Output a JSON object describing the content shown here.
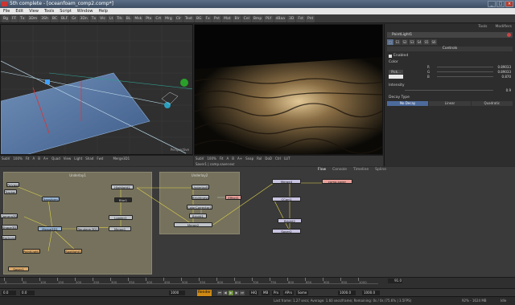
{
  "window": {
    "title": "5th complete - [oceanfoam_comp2.comp*]",
    "controls": [
      "_",
      "□",
      "×"
    ]
  },
  "menu": [
    "File",
    "Edit",
    "View",
    "Tools",
    "Script",
    "Window",
    "Help"
  ],
  "toolbar": [
    "Bg",
    "FF",
    "Tx",
    "3Dm",
    "3Sh",
    "BC",
    "BLF",
    "Gr",
    "3Dn",
    "Tx",
    "Vlc",
    "Lt",
    "Trk",
    "BL",
    "Msk",
    "Ptx",
    "Crt",
    "Mrg",
    "Clr",
    "Text",
    "BG",
    "Fx",
    "Pnt",
    "Mat",
    "Blr",
    "Cel",
    "Bmp",
    "PLY",
    "dBaa",
    "3D",
    "Fst",
    "Pnt"
  ],
  "viewer1": {
    "label": "Perspective",
    "bar": [
      "SubV",
      "100%",
      "Fit",
      "A",
      "B",
      "A+",
      "Quad",
      "View",
      "Light",
      "Shad",
      "Fwd"
    ],
    "camera": "Merge3D1"
  },
  "viewer2": {
    "bar": [
      "SubV",
      "100%",
      "Fit",
      "A",
      "B",
      "A+",
      "Snap",
      "RoI",
      "DoD",
      "Ctrl",
      "LUT"
    ],
    "info": "Saver1 | comp.saver.exr"
  },
  "panel": {
    "tabs": [
      "Tools",
      "Modifiers"
    ],
    "header": "PointLight1",
    "tool_tabs": [
      "□",
      "S1",
      "S2",
      "S3",
      "S4",
      "S5",
      "S6"
    ],
    "section": "Controls",
    "enabled": "Enabled",
    "color_label": "Color",
    "color_rows": [
      {
        "k": "R",
        "v": "0.89033"
      },
      {
        "k": "G",
        "v": "0.89033"
      },
      {
        "k": "B",
        "v": "0.870"
      }
    ],
    "pick": "Pick...",
    "intensity_label": "Intensity",
    "intensity": "0.9",
    "decay_label": "Decay Type",
    "decay": [
      "No Decay",
      "Linear",
      "Quadratic"
    ]
  },
  "flow": {
    "tabs": [
      "Flow",
      "Console",
      "Timeline",
      "Spline"
    ],
    "groups": [
      {
        "label": "Underlay1"
      },
      {
        "label": "Underlay2"
      }
    ],
    "nodes": [
      "Polygon1",
      "Tracker1",
      "Transform1",
      "Merge3D1",
      "Camera3D1",
      "Shape3D1",
      "Renderer3D1",
      "Background1",
      "PointLight1",
      "Spotlight1",
      "Saver1",
      "Highlight1",
      "Blur1",
      "Loader1",
      "Merge1",
      "UnderlayRes",
      "Brightness1",
      "ColorCorrector1",
      "Effect1",
      "Bright1",
      "Merge2",
      "Merge4",
      "CCorr1",
      "Bright2",
      "Saver2",
      "comp.saver",
      "Gamut",
      "Merge3",
      "Ellipse1"
    ]
  },
  "timeline": {
    "ticks": [
      "0",
      "50",
      "100",
      "150",
      "200",
      "250",
      "300",
      "350",
      "400",
      "450",
      "500",
      "550",
      "600",
      "650",
      "700",
      "750",
      "800",
      "850",
      "900",
      "950",
      "1000"
    ],
    "current": "91.0"
  },
  "transport": {
    "start": "0.0",
    "start2": "0.0",
    "end": "1000",
    "render": "Render",
    "hq": "HiQ",
    "mb": "MB",
    "prx": "Prx",
    "aprx": "APrx",
    "some": "Some",
    "end2": "1000.0",
    "end3": "1000.0"
  },
  "status": {
    "text": "Last frame: 1.27 secs; Average: 1.60 secs/frame; Remaining: 0s / 0s (75.6% | 3.5FPS)",
    "mem": "92% - 1624 MB",
    "idle": "Idle"
  }
}
